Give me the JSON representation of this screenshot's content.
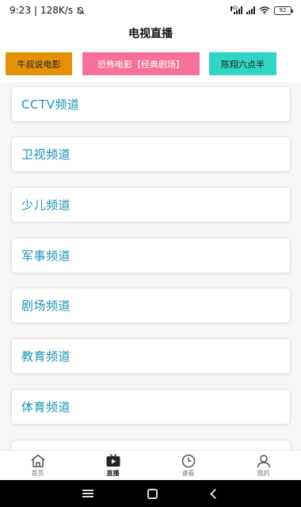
{
  "status": {
    "time": "9:23",
    "speed": "128K/s",
    "battery": "92"
  },
  "header": {
    "title": "电视直播"
  },
  "tags": [
    {
      "label": "牛叔说电影",
      "color": "#e39208"
    },
    {
      "label": "恐怖电影【经典剧场】",
      "color": "#f7709a"
    },
    {
      "label": "陈翔六点半",
      "color": "#2fd6c6"
    }
  ],
  "channels": [
    {
      "label": "CCTV频道"
    },
    {
      "label": "卫视频道"
    },
    {
      "label": "少儿频道"
    },
    {
      "label": "军事频道"
    },
    {
      "label": "剧场频道"
    },
    {
      "label": "教育频道"
    },
    {
      "label": "体育频道"
    }
  ],
  "bottom_nav": [
    {
      "label": "首页",
      "icon": "home-icon",
      "active": false
    },
    {
      "label": "直播",
      "icon": "tv-play-icon",
      "active": true
    },
    {
      "label": "速看",
      "icon": "clock-icon",
      "active": false
    },
    {
      "label": "我的",
      "icon": "user-icon",
      "active": false
    }
  ],
  "colors": {
    "channel_text": "#1b93b6",
    "accent_orange": "#e39208",
    "accent_pink": "#f7709a",
    "accent_teal": "#2fd6c6"
  }
}
